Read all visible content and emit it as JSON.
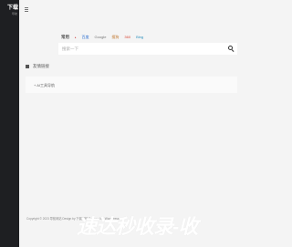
{
  "brand": {
    "main": "下载",
    "sub": "导航"
  },
  "search": {
    "engines": [
      {
        "label": "常用",
        "key": "common"
      },
      {
        "label": "百度",
        "key": "baidu"
      },
      {
        "label": "Google",
        "key": "google"
      },
      {
        "label": "搜狗",
        "key": "sogou"
      },
      {
        "label": "360",
        "key": "so360"
      },
      {
        "label": "Bing",
        "key": "bing"
      }
    ],
    "placeholder": "搜索一下"
  },
  "links_section": {
    "title": "友情链接"
  },
  "links": [
    "+ AI工具导航"
  ],
  "footer": {
    "text": "Copyright © 2023 导航网站    Design by 下载导航    Powered by WordPress"
  },
  "watermark": {
    "text": "速达秒收录-收"
  },
  "colors": {
    "sidebar": "#1e1f22",
    "background": "#f4f4f4",
    "accent": "#2d6fd1"
  }
}
